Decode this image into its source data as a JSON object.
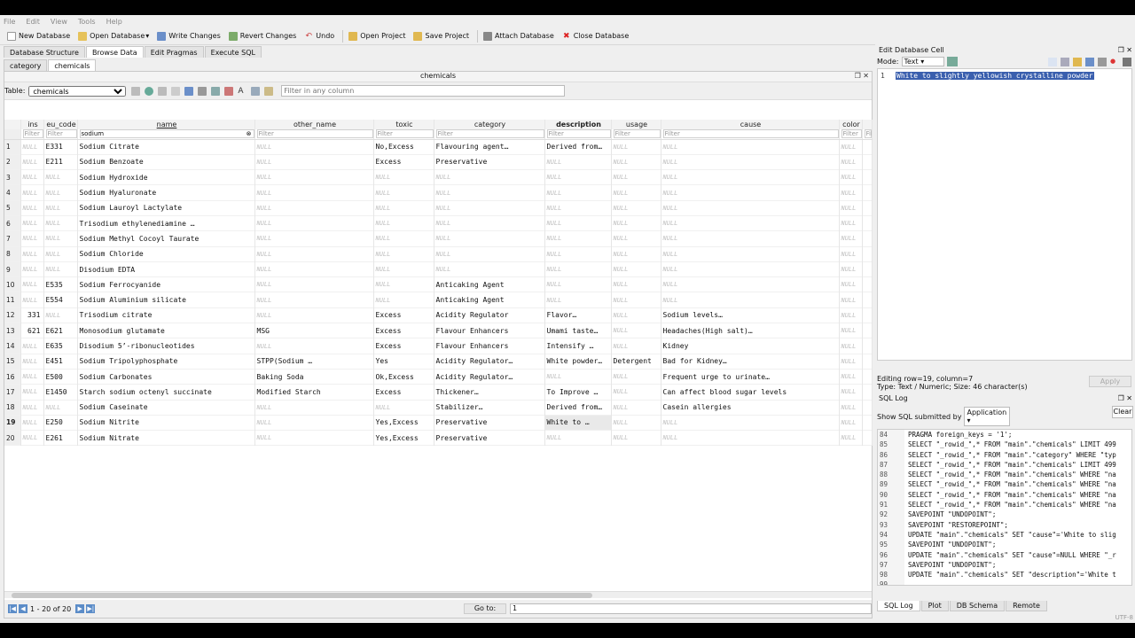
{
  "menu": [
    "File",
    "Edit",
    "View",
    "Tools",
    "Help"
  ],
  "toolbar": {
    "new_db": "New Database",
    "open_db": "Open Database",
    "write": "Write Changes",
    "revert": "Revert Changes",
    "undo": "Undo",
    "open_proj": "Open Project",
    "save_proj": "Save Project",
    "attach": "Attach Database",
    "close_db": "Close Database"
  },
  "main_tabs": [
    "Database Structure",
    "Browse Data",
    "Edit Pragmas",
    "Execute SQL"
  ],
  "sub_tabs": [
    "category",
    "chemicals"
  ],
  "pane_title": "chemicals",
  "table_label": "Table:",
  "table_selected": "chemicals",
  "filter_all_placeholder": "Filter in any column",
  "columns": [
    "ins",
    "eu_code",
    "name",
    "other_name",
    "toxic",
    "category",
    "description",
    "usage",
    "cause",
    "color",
    ""
  ],
  "filter_placeholder": "Filter",
  "name_filter_value": "sodium",
  "rows": [
    [
      "1",
      "NULL",
      "E331",
      "Sodium Citrate",
      "NULL",
      "No,Excess",
      "Flavouring agent…",
      "Derived from…",
      "NULL",
      "NULL",
      "NULL"
    ],
    [
      "2",
      "NULL",
      "E211",
      "Sodium Benzoate",
      "NULL",
      "Excess",
      "Preservative",
      "NULL",
      "NULL",
      "NULL",
      "NULL"
    ],
    [
      "3",
      "NULL",
      "NULL",
      "Sodium Hydroxide",
      "NULL",
      "NULL",
      "NULL",
      "NULL",
      "NULL",
      "NULL",
      "NULL"
    ],
    [
      "4",
      "NULL",
      "NULL",
      "Sodium Hyaluronate",
      "NULL",
      "NULL",
      "NULL",
      "NULL",
      "NULL",
      "NULL",
      "NULL"
    ],
    [
      "5",
      "NULL",
      "NULL",
      "Sodium Lauroyl Lactylate",
      "NULL",
      "NULL",
      "NULL",
      "NULL",
      "NULL",
      "NULL",
      "NULL"
    ],
    [
      "6",
      "NULL",
      "NULL",
      "Trisodium ethylenediamine …",
      "NULL",
      "NULL",
      "NULL",
      "NULL",
      "NULL",
      "NULL",
      "NULL"
    ],
    [
      "7",
      "NULL",
      "NULL",
      "Sodium Methyl Cocoyl Taurate",
      "NULL",
      "NULL",
      "NULL",
      "NULL",
      "NULL",
      "NULL",
      "NULL"
    ],
    [
      "8",
      "NULL",
      "NULL",
      "Sodium Chloride",
      "NULL",
      "NULL",
      "NULL",
      "NULL",
      "NULL",
      "NULL",
      "NULL"
    ],
    [
      "9",
      "NULL",
      "NULL",
      "Disodium EDTA",
      "NULL",
      "NULL",
      "NULL",
      "NULL",
      "NULL",
      "NULL",
      "NULL"
    ],
    [
      "10",
      "NULL",
      "E535",
      "Sodium Ferrocyanide",
      "NULL",
      "NULL",
      "Anticaking Agent",
      "NULL",
      "NULL",
      "NULL",
      "NULL"
    ],
    [
      "11",
      "NULL",
      "E554",
      "Sodium Aluminium silicate",
      "NULL",
      "NULL",
      "Anticaking Agent",
      "NULL",
      "NULL",
      "NULL",
      "NULL"
    ],
    [
      "12",
      "331",
      "NULL",
      "Trisodium citrate",
      "NULL",
      "Excess",
      "Acidity Regulator",
      "Flavor…",
      "NULL",
      "Sodium levels…",
      "NULL"
    ],
    [
      "13",
      "621",
      "E621",
      "Monosodium glutamate",
      "MSG",
      "Excess",
      "Flavour Enhancers",
      "Umami taste…",
      "NULL",
      "Headaches(High salt)…",
      "NULL"
    ],
    [
      "14",
      "NULL",
      "E635",
      "Disodium 5’-ribonucleotides",
      "NULL",
      "Excess",
      "Flavour Enhancers",
      "Intensify …",
      "NULL",
      "Kidney",
      "NULL"
    ],
    [
      "15",
      "NULL",
      "E451",
      "Sodium Tripolyphosphate",
      "STPP(Sodium …",
      "Yes",
      "Acidity Regulator…",
      "White powder…",
      "Detergent",
      "Bad for Kidney…",
      "NULL"
    ],
    [
      "16",
      "NULL",
      "E500",
      "Sodium Carbonates",
      "Baking Soda",
      "Ok,Excess",
      "Acidity Regulator…",
      "NULL",
      "NULL",
      "Frequent urge to urinate…",
      "NULL"
    ],
    [
      "17",
      "NULL",
      "E1450",
      "Starch sodium octenyl succinate",
      "Modified Starch",
      "Excess",
      "Thickener…",
      "To Improve …",
      "NULL",
      "Can affect blood sugar levels",
      "NULL"
    ],
    [
      "18",
      "NULL",
      "NULL",
      "Sodium Caseinate",
      "NULL",
      "NULL",
      "Stabilizer…",
      "Derived from…",
      "NULL",
      "Casein allergies",
      "NULL"
    ],
    [
      "19",
      "NULL",
      "E250",
      "Sodium Nitrite",
      "NULL",
      "Yes,Excess",
      "Preservative",
      "White to …",
      "NULL",
      "NULL",
      "NULL"
    ],
    [
      "20",
      "NULL",
      "E261",
      "Sodium Nitrate",
      "NULL",
      "Yes,Excess",
      "Preservative",
      "NULL",
      "NULL",
      "NULL",
      "NULL"
    ]
  ],
  "nav": {
    "record_count": "1 - 20 of 20",
    "goto_label": "Go to:",
    "goto_value": "1"
  },
  "edit_cell": {
    "title": "Edit Database Cell",
    "mode_label": "Mode:",
    "mode_value": "Text",
    "line": "1",
    "content": "White to slightly yellowish crystalline powder",
    "status1": "Editing row=19, column=7",
    "status2": "Type: Text / Numeric; Size: 46 character(s)",
    "apply": "Apply"
  },
  "sql_log": {
    "title": "SQL Log",
    "show_label": "Show SQL submitted by",
    "source": "Application",
    "clear": "Clear",
    "lines": [
      {
        "n": "84",
        "t": "PRAGMA foreign_keys = '1';"
      },
      {
        "n": "85",
        "t": "SELECT \"_rowid_\",* FROM \"main\".\"chemicals\" LIMIT 499"
      },
      {
        "n": "86",
        "t": "SELECT \"_rowid_\",* FROM \"main\".\"category\" WHERE \"typ"
      },
      {
        "n": "87",
        "t": "SELECT \"_rowid_\",* FROM \"main\".\"chemicals\" LIMIT 499"
      },
      {
        "n": "88",
        "t": "SELECT \"_rowid_\",* FROM \"main\".\"chemicals\" WHERE \"na"
      },
      {
        "n": "89",
        "t": "SELECT \"_rowid_\",* FROM \"main\".\"chemicals\" WHERE \"na"
      },
      {
        "n": "90",
        "t": "SELECT \"_rowid_\",* FROM \"main\".\"chemicals\" WHERE \"na"
      },
      {
        "n": "91",
        "t": "SELECT \"_rowid_\",* FROM \"main\".\"chemicals\" WHERE \"na"
      },
      {
        "n": "92",
        "t": "SAVEPOINT \"UNDOPOINT\";"
      },
      {
        "n": "93",
        "t": "SAVEPOINT \"RESTOREPOINT\";"
      },
      {
        "n": "94",
        "t": "UPDATE \"main\".\"chemicals\" SET \"cause\"='White to slig"
      },
      {
        "n": "95",
        "t": "SAVEPOINT \"UNDOPOINT\";"
      },
      {
        "n": "96",
        "t": "UPDATE \"main\".\"chemicals\" SET \"cause\"=NULL WHERE \"_r"
      },
      {
        "n": "97",
        "t": "SAVEPOINT \"UNDOPOINT\";"
      },
      {
        "n": "98",
        "t": "UPDATE \"main\".\"chemicals\" SET \"description\"='White t"
      },
      {
        "n": "99",
        "t": ""
      }
    ]
  },
  "bottom_tabs": [
    "SQL Log",
    "Plot",
    "DB Schema",
    "Remote"
  ],
  "encoding": "UTF-8"
}
